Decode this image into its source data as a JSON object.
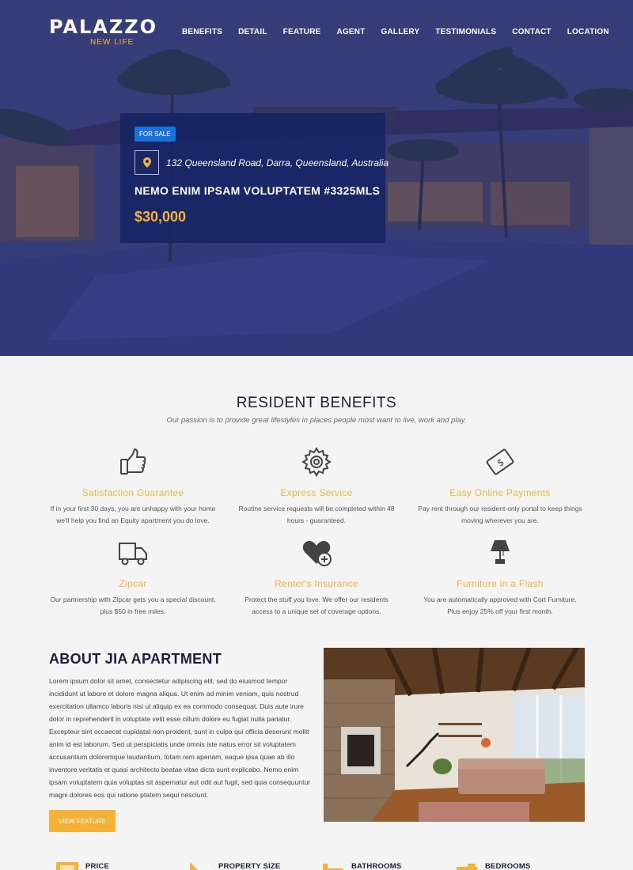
{
  "brand": {
    "name": "PALAZZO",
    "tagline": "NEW LIFE"
  },
  "nav": [
    "BENEFITS",
    "DETAIL",
    "FEATURE",
    "AGENT",
    "GALLERY",
    "TESTIMONIALS",
    "CONTACT",
    "LOCATION"
  ],
  "listing": {
    "badge": "FOR SALE",
    "address": "132 Queensland Road, Darra, Queensland, Australia",
    "title": "NEMO ENIM IPSAM VOLUPTATEM #3325MLS",
    "price": "$30,000"
  },
  "benefits": {
    "title": "RESIDENT BENEFITS",
    "subtitle": "Our passion is to provide great lifestyles in places people most want to live, work and play.",
    "items": [
      {
        "icon": "thumbs-up-icon",
        "title": "Satisfaction Guarantee",
        "text": "If in your first 30 days, you are unhappy with your home we'll help you find an Equity apartment you do love."
      },
      {
        "icon": "gear-icon",
        "title": "Express Service",
        "text": "Routine service requests will be completed within 48 hours - guaranteed."
      },
      {
        "icon": "money-icon",
        "title": "Easy Online Payments",
        "text": "Pay rent through our resident-only portal to keep things moving wherever you are."
      },
      {
        "icon": "truck-icon",
        "title": "Zipcar",
        "text": "Our partnership with Zipcar gets you a special discount, plus $50 in free miles."
      },
      {
        "icon": "heart-plus-icon",
        "title": "Renter's Insurance",
        "text": "Protect the stuff you love. We offer our residents access to a unique set of coverage options."
      },
      {
        "icon": "lamp-icon",
        "title": "Furniture in a Flash",
        "text": "You are automatically approved with Cort Furniture. Plus enjoy 25% off your first month."
      }
    ]
  },
  "about": {
    "title": "ABOUT JIA APARTMENT",
    "text": "Lorem ipsum dolor sit amet, consectetur adipiscing elit, sed do eiusmod tempor incididunt ut labore et dolore magna aliqua. Ut enim ad minim veniam, quis nostrud exercitation ullamco laboris nisi ut aliquip ex ea commodo consequat. Duis aute irure dolor in reprehenderit in voluptate velit esse cillum dolore eu fugiat nulla pariatur. Excepteur sint occaecat cupidatat non proident, sunt in culpa qui officia deserunt mollit anim id est laborum. Sed ut perspiciatis unde omnis iste natus error sit voluptatem accusantium doloremque laudantium, totam rem aperiam, eaque ipsa quae ab illo inventore veritatis et quasi architecto beatae vitae dicta sunt explicabo. Nemo enim ipsam voluptatem quia voluptas sit aspernatur aut odit aut fugit, sed quia consequuntur magni dolores eos qui ratione ptatem sequi nesciunt.",
    "button": "VIEW FEATURE"
  },
  "stats": [
    {
      "icon": "price-icon",
      "label": "PRICE"
    },
    {
      "icon": "ruler-icon",
      "label": "PROPERTY SIZE"
    },
    {
      "icon": "bath-icon",
      "label": "BATHROOMS"
    },
    {
      "icon": "bed-icon",
      "label": "BEDROOMS"
    }
  ],
  "colors": {
    "accent": "#f4b23a",
    "navy": "#1b1f3b",
    "hero_overlay": "#2e3680",
    "badge": "#1a72d9"
  }
}
